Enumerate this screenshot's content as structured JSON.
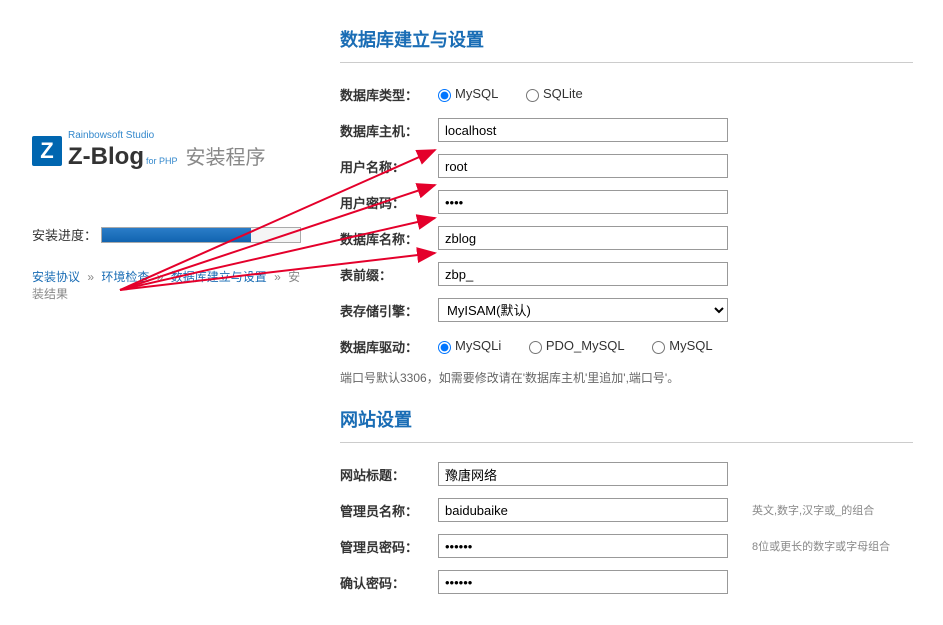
{
  "brand": {
    "studio": "Rainbowsoft Studio",
    "name": "Z-Blog",
    "php": "for PHP",
    "install_suffix": "安装程序"
  },
  "progress": {
    "label": "安装进度："
  },
  "breadcrumb": {
    "step1": "安装协议",
    "step2": "环境检查",
    "step3": "数据库建立与设置",
    "step4": "安装结果",
    "sep": "»"
  },
  "db_section": {
    "title": "数据库建立与设置",
    "type_label": "数据库类型：",
    "type_opts": {
      "mysql": "MySQL",
      "sqlite": "SQLite"
    },
    "host_label": "数据库主机：",
    "host_value": "localhost",
    "user_label": "用户名称：",
    "user_value": "root",
    "pass_label": "用户密码：",
    "pass_value": "••••",
    "dbname_label": "数据库名称：",
    "dbname_value": "zblog",
    "prefix_label": "表前缀：",
    "prefix_value": "zbp_",
    "engine_label": "表存储引擎：",
    "engine_value": "MyISAM(默认)",
    "driver_label": "数据库驱动：",
    "driver_opts": {
      "mysqli": "MySQLi",
      "pdo": "PDO_MySQL",
      "mysql": "MySQL"
    },
    "port_note": "端口号默认3306，如需要修改请在'数据库主机'里追加',端口号'。"
  },
  "site_section": {
    "title": "网站设置",
    "site_title_label": "网站标题：",
    "site_title_value": "豫唐网络",
    "admin_name_label": "管理员名称：",
    "admin_name_value": "baidubaike",
    "admin_name_hint": "英文,数字,汉字或_的组合",
    "admin_pass_label": "管理员密码：",
    "admin_pass_value": "••••••",
    "admin_pass_hint": "8位或更长的数字或字母组合",
    "confirm_pass_label": "确认密码：",
    "confirm_pass_value": "••••••"
  }
}
